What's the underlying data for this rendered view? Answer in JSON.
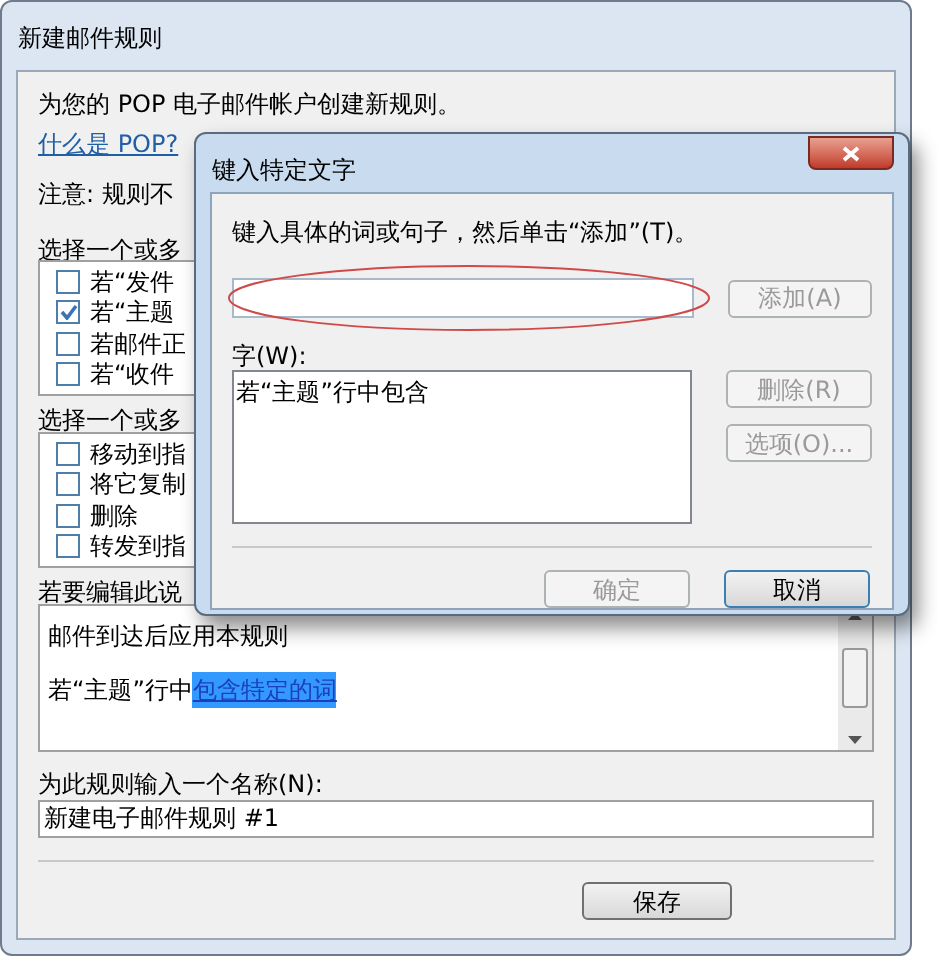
{
  "window": {
    "title": "新建邮件规则"
  },
  "intro": "为您的 POP 电子邮件帐户创建新规则。",
  "help_link": "什么是 POP?",
  "note": "注意: 规则不",
  "conditions": {
    "label": "选择一个或多",
    "items": [
      {
        "label": "若“发件",
        "checked": false
      },
      {
        "label": "若“主题",
        "checked": true
      },
      {
        "label": "若邮件正",
        "checked": false
      },
      {
        "label": "若“收件",
        "checked": false
      }
    ]
  },
  "actions": {
    "label": "选择一个或多",
    "items": [
      {
        "label": "移动到指",
        "checked": false
      },
      {
        "label": "将它复制",
        "checked": false
      },
      {
        "label": "删除",
        "checked": false
      },
      {
        "label": "转发到指",
        "checked": false
      }
    ]
  },
  "description": {
    "label": "若要编辑此说",
    "lines": [
      {
        "text": "邮件到达后应用本规则"
      },
      {
        "text": "若“主题”行中",
        "link": "包含特定的词",
        "link_selected": true
      }
    ]
  },
  "name_field": {
    "label": "为此规则输入一个名称(N):",
    "value": "新建电子邮件规则 #1"
  },
  "save_button": {
    "label": "保存",
    "disabled": false
  },
  "dialog": {
    "title": "键入特定文字",
    "prompt": "键入具体的词或句子，然后单击“添加”(T)。",
    "add_button": {
      "label": "添加(A)",
      "disabled": true
    },
    "words_label": "字(W):",
    "words": [
      {
        "text": "若“主题”行中包含",
        "selected": false
      }
    ],
    "side_buttons": [
      {
        "label": "删除(R)",
        "disabled": true
      },
      {
        "label": "选项(O)...",
        "disabled": true
      }
    ],
    "footer_buttons": [
      {
        "label": "确定",
        "disabled": true,
        "default": false
      },
      {
        "label": "取消",
        "disabled": false,
        "default": true
      }
    ]
  }
}
